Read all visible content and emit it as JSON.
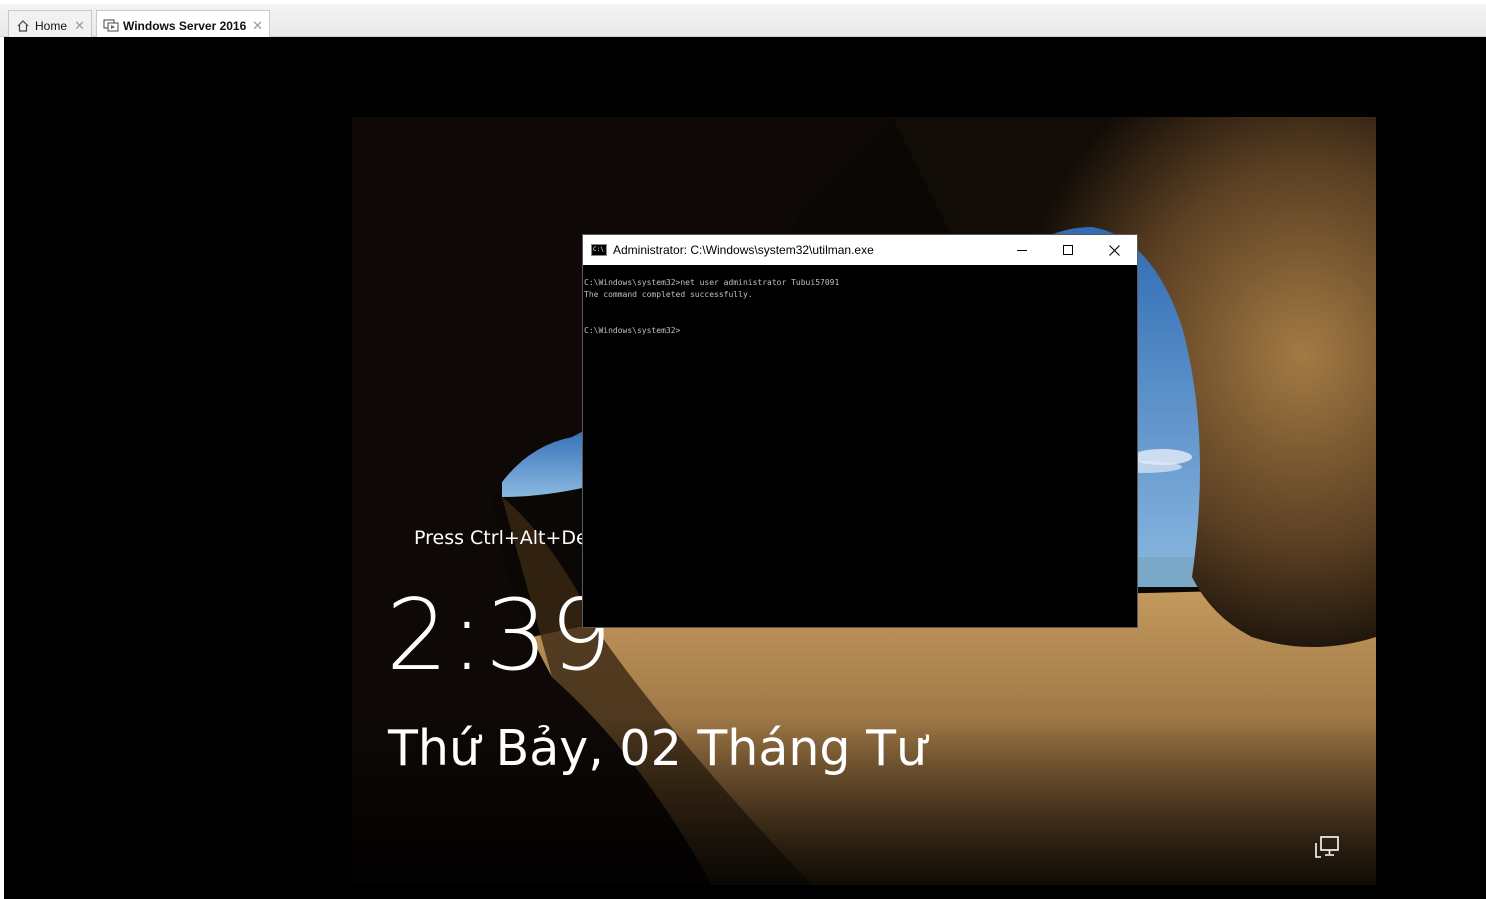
{
  "tabs": [
    {
      "label": "Home",
      "icon": "home-icon"
    },
    {
      "label": "Windows Server 2016",
      "icon": "vm-icon",
      "active": true
    }
  ],
  "lockscreen": {
    "prompt": "Press Ctrl+Alt+Dele",
    "time": "2:39",
    "date": "Thứ Bảy, 02 Tháng Tư",
    "network_icon": "network-icon"
  },
  "cmd": {
    "title": "Administrator: C:\\Windows\\system32\\utilman.exe",
    "lines": [
      "C:\\Windows\\system32>net user administrator Tubui57091",
      "The command completed successfully.",
      "",
      "",
      "C:\\Windows\\system32>"
    ]
  },
  "colors": {
    "console_bg": "#000000",
    "console_text": "#c0c0c0",
    "sky": "#3f7cc4",
    "sand": "#b58a52"
  }
}
